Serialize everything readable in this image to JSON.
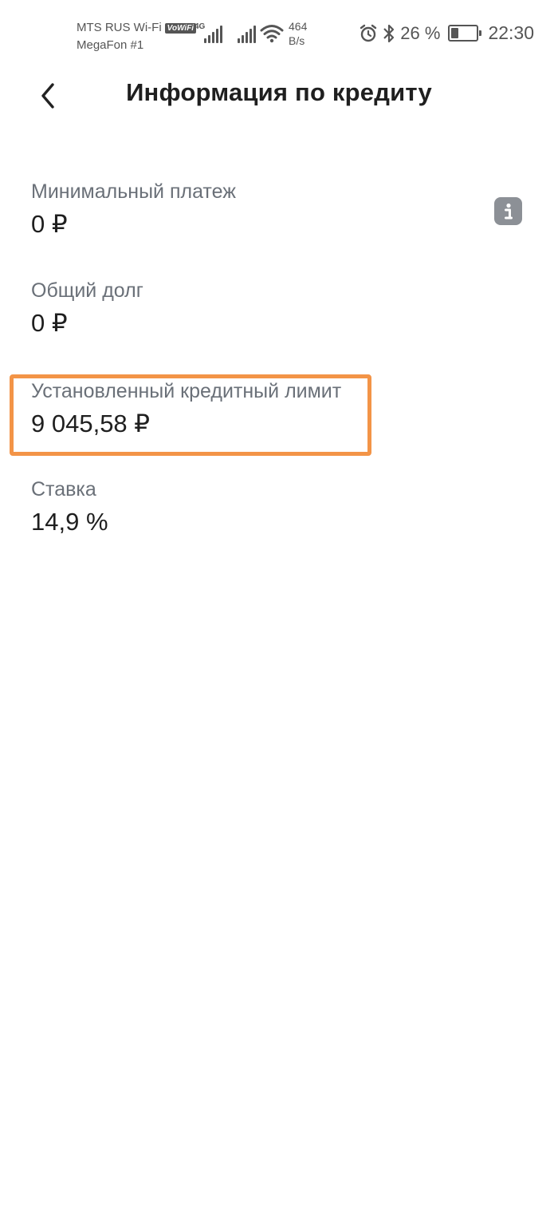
{
  "status_bar": {
    "carrier_primary": "MTS RUS Wi-Fi",
    "vowifi_badge": "VoWiFi",
    "carrier_secondary": "MegaFon #1",
    "network_type": "4G",
    "net_speed_value": "464",
    "net_speed_unit": "B/s",
    "battery_percent": "26 %",
    "battery_level": 0.26,
    "time": "22:30",
    "icons": [
      "signal-icon",
      "signal-icon",
      "wifi-icon",
      "alarm-icon",
      "bluetooth-icon",
      "battery-icon"
    ]
  },
  "header": {
    "back_icon": "chevron-left-icon",
    "title": "Информация по кредиту"
  },
  "info": {
    "min_payment_label": "Минимальный платеж",
    "min_payment_value": "0 ₽",
    "info_icon": "info-icon",
    "total_debt_label": "Общий долг",
    "total_debt_value": "0 ₽",
    "credit_limit_label": "Установленный кредитный лимит",
    "credit_limit_value": "9 045,58 ₽",
    "rate_label": "Ставка",
    "rate_value": "14,9 %"
  },
  "colors": {
    "highlight": "#f39447",
    "label": "#6a7078",
    "value": "#1f1f1f",
    "info_button": "#8c9096"
  }
}
